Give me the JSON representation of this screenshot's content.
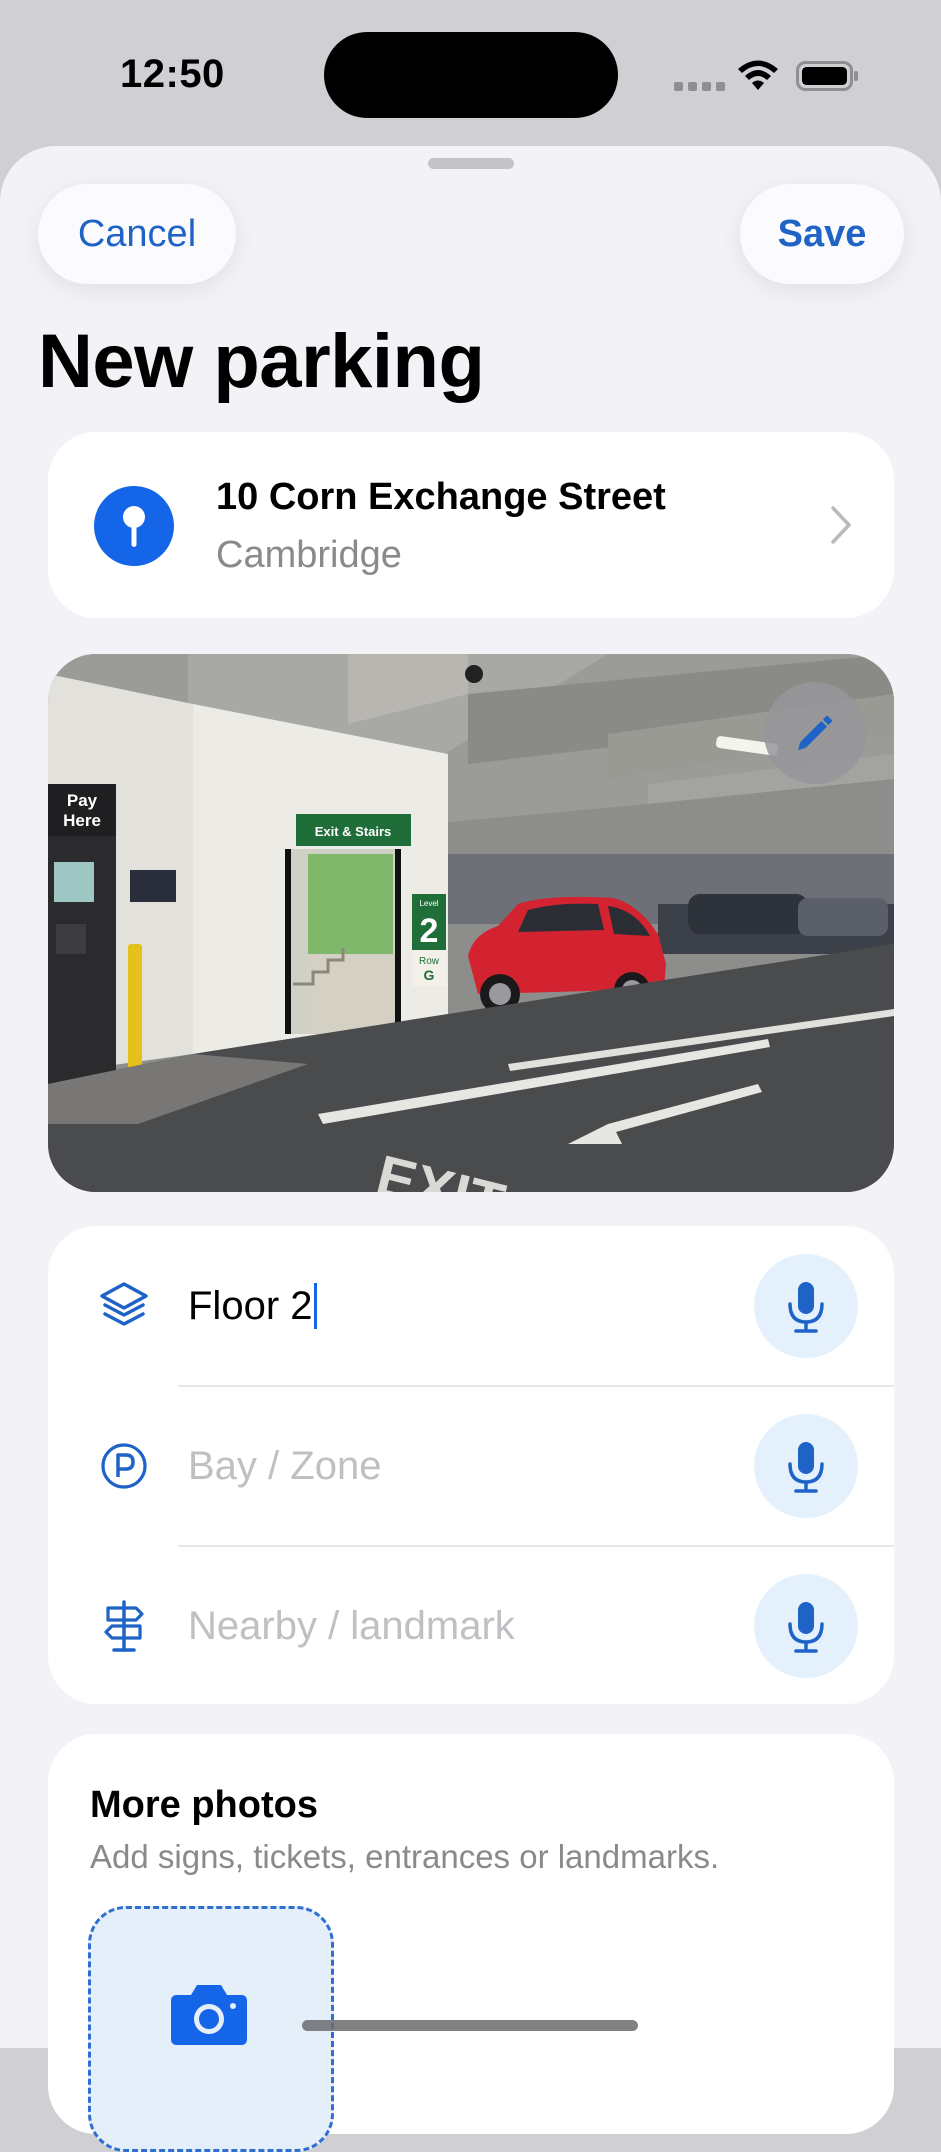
{
  "status_bar": {
    "time": "12:50"
  },
  "sheet": {
    "cancel_label": "Cancel",
    "save_label": "Save",
    "title": "New parking"
  },
  "location": {
    "street": "10 Corn Exchange Street",
    "city": "Cambridge"
  },
  "photo": {
    "signs": {
      "pay_line1": "Pay",
      "pay_line2": "Here",
      "exit_stairs": "Exit & Stairs",
      "level_word": "Level",
      "level_number": "2",
      "row_word": "Row",
      "row_letter": "G",
      "floor_marking": "EXIT"
    }
  },
  "fields": {
    "floor": {
      "value": "Floor 2",
      "icon": "layers-icon"
    },
    "bay": {
      "placeholder": "Bay / Zone",
      "icon": "parking-circle-icon"
    },
    "landmark": {
      "placeholder": "Nearby / landmark",
      "icon": "signpost-icon"
    }
  },
  "more_photos": {
    "title": "More photos",
    "subtitle": "Add signs, tickets, entrances or landmarks."
  },
  "colors": {
    "accent": "#1f63c7",
    "sheet_bg": "#f2f2f7",
    "mic_bg": "#e4f0fc"
  }
}
